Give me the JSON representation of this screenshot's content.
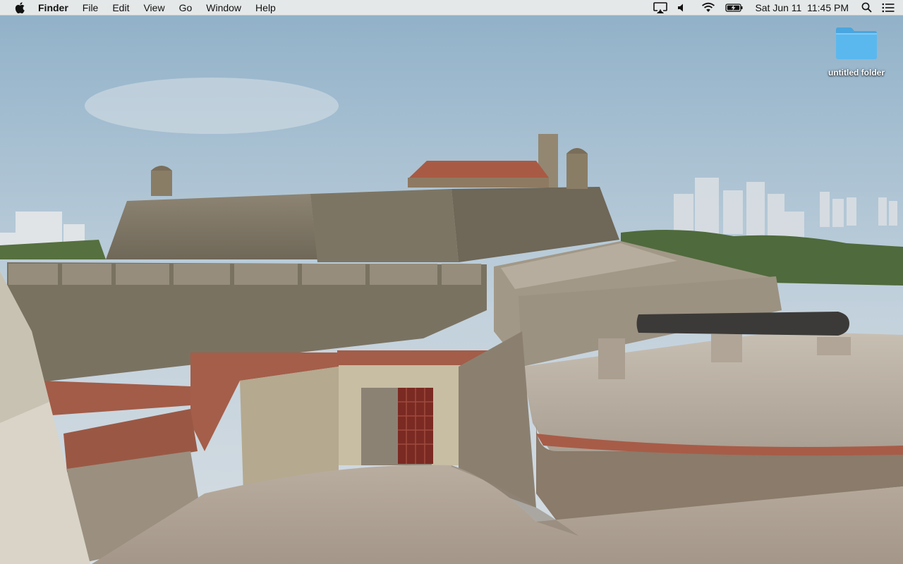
{
  "menubar": {
    "apple_icon": "apple-logo-icon",
    "app_name": "Finder",
    "menus": [
      "File",
      "Edit",
      "View",
      "Go",
      "Window",
      "Help"
    ],
    "status_icons": [
      "airplay-icon",
      "volume-icon",
      "wifi-icon",
      "battery-charging-icon"
    ],
    "clock": "Sat Jun 11  11:45 PM",
    "spotlight_icon": "spotlight-search-icon",
    "notification_icon": "notification-center-icon"
  },
  "desktop": {
    "icons": [
      {
        "label": "untitled folder",
        "type": "folder-icon",
        "color": "#5ab8ee"
      }
    ],
    "wallpaper": "fortress-wallpaper"
  },
  "colors": {
    "menubar_bg": "#ececec",
    "folder_blue": "#5ab8ee",
    "sky": "#b9cbd8"
  }
}
